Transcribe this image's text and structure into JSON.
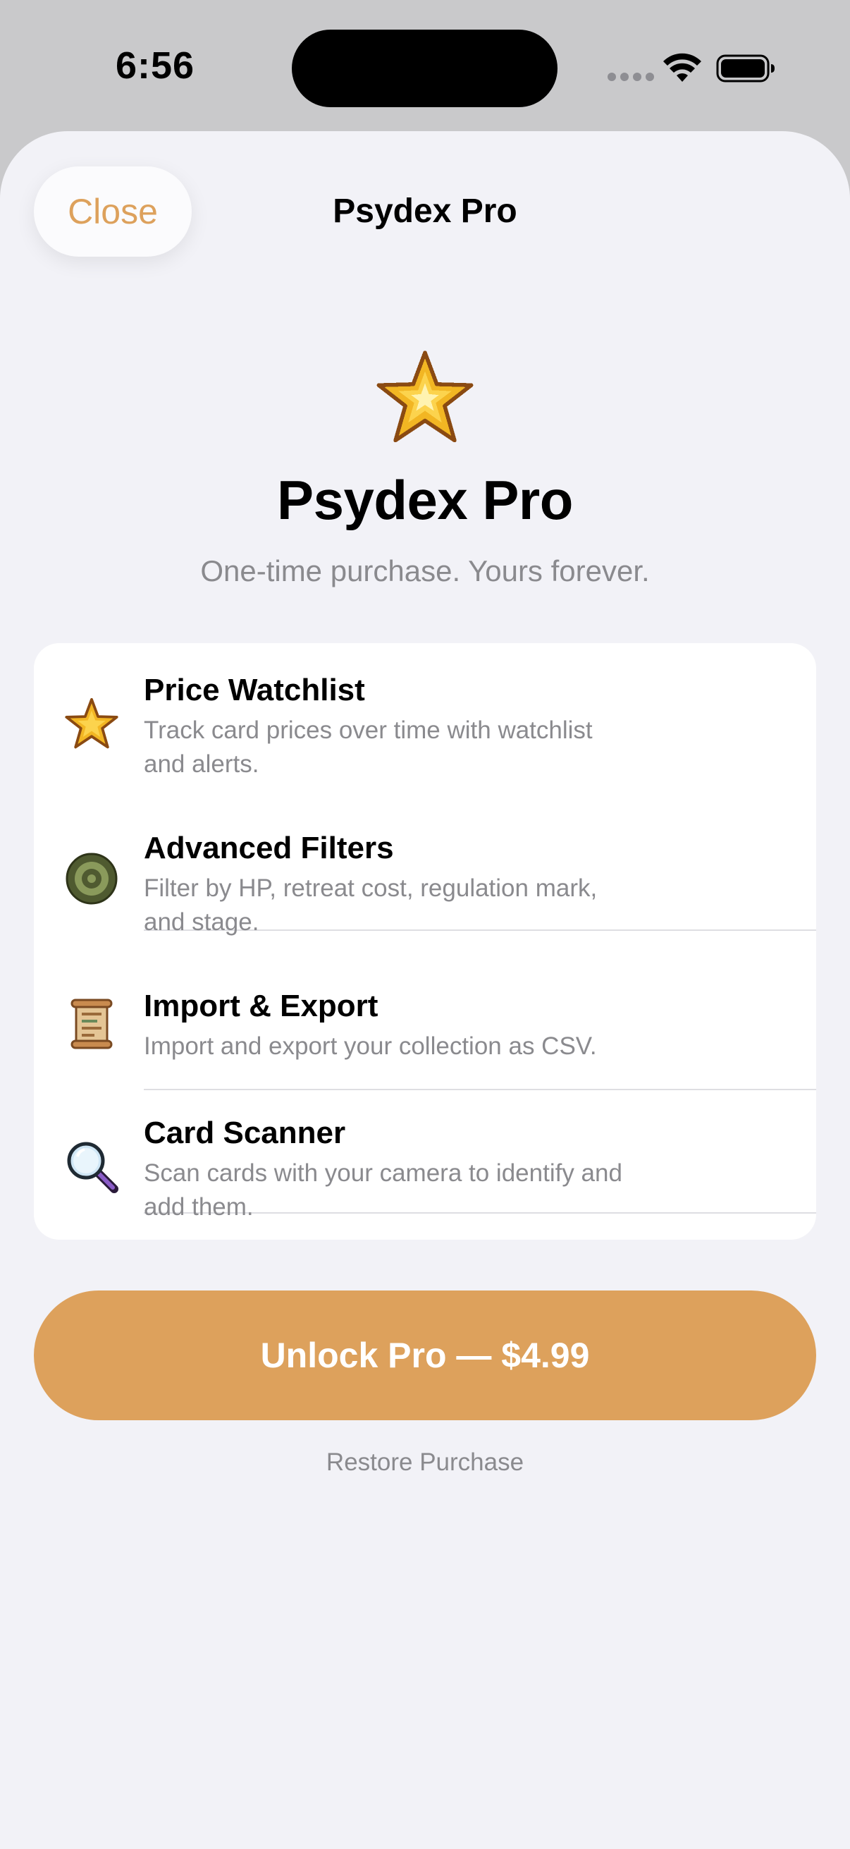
{
  "status_bar": {
    "time": "6:56"
  },
  "nav": {
    "close_label": "Close",
    "title": "Psydex Pro"
  },
  "hero": {
    "icon": "pixel-star-icon",
    "title": "Psydex Pro",
    "subtitle": "One-time purchase. Yours forever."
  },
  "features": [
    {
      "icon": "pixel-star-icon",
      "title": "Price Watchlist",
      "description_line1": "Track card prices over time with watchlist",
      "description_line2": "and alerts."
    },
    {
      "icon": "target-icon",
      "title": "Advanced Filters",
      "description_line1": "Filter by HP, retreat cost, regulation mark,",
      "description_line2": "and stage."
    },
    {
      "icon": "scroll-icon",
      "title": "Import & Export",
      "description_line1": "Import and export your collection as CSV."
    },
    {
      "icon": "magnifying-glass-icon",
      "title": "Card Scanner",
      "description_line1": "Scan cards with your camera to identify and",
      "description_line2": "add them."
    }
  ],
  "purchase": {
    "unlock_label": "Unlock Pro — $4.99",
    "restore_label": "Restore Purchase"
  },
  "colors": {
    "accent": "#dda15c",
    "background": "#f2f2f7",
    "card": "#ffffff",
    "secondary_text": "#8a8a8e"
  }
}
